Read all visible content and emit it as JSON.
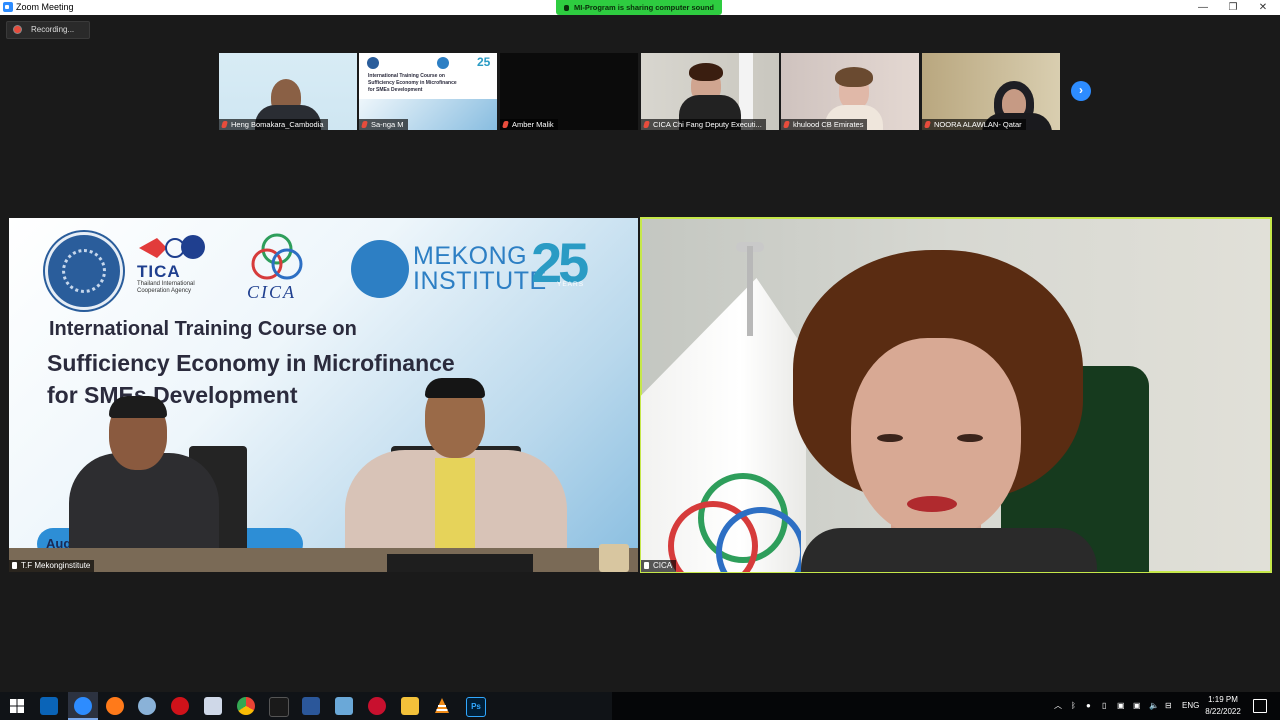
{
  "window": {
    "title": "Zoom Meeting",
    "sharing_banner": "MI-Program is sharing computer sound",
    "minimize": "—",
    "restore": "❐",
    "close": "✕"
  },
  "recording": {
    "label": "Recording..."
  },
  "thumbnails": [
    {
      "name": "Heng Bomakara_Cambodia"
    },
    {
      "name": "Sa-nga M"
    },
    {
      "name": "Amber Malik"
    },
    {
      "name": "CICA Chi Fang Deputy Executi..."
    },
    {
      "name": "khulood CB Emirates"
    },
    {
      "name": "NOORA ALAWLAN- Qatar"
    }
  ],
  "thumb2_slide": {
    "line1": "International Training Course on",
    "line2": "Sufficiency Economy in Microfinance",
    "line3": "for SMEs Development"
  },
  "next_arrow": "›",
  "main_left": {
    "name": "T.F Mekonginstitute",
    "slide": {
      "tica": "TICA",
      "tica_sub": "Thailand International Cooperation Agency",
      "cica": "CICA",
      "mekong": "MEKONG",
      "institute": "INSTITUTE",
      "years_num": "25",
      "years_label": "YEARS",
      "line1": "International Training Course on",
      "line2": "Sufficiency Economy in Microfinance",
      "line3": "for SMEs Development",
      "date_prefix": "Aug"
    }
  },
  "main_right": {
    "name": "CICA"
  },
  "taskbar": {
    "icons": [
      "windows-start",
      "outlook",
      "zoom",
      "firefox",
      "paint",
      "opera",
      "notepad",
      "chrome",
      "terminal",
      "word",
      "notes",
      "reader",
      "file-explorer",
      "vlc",
      "photoshop"
    ],
    "tray_lang": "ENG",
    "time": "1:19 PM",
    "date": "8/22/2022"
  },
  "colors": {
    "active_speaker_border": "#c6e84a",
    "banner_green": "#2ecc40",
    "zoom_blue": "#2d8cff"
  }
}
